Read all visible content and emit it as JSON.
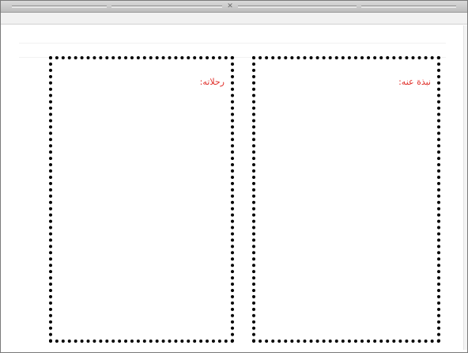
{
  "page": {
    "boxes": [
      {
        "id": "travels",
        "label": "رحلاته:"
      },
      {
        "id": "bio",
        "label": "نبذة عنه:"
      }
    ]
  },
  "colors": {
    "label": "#e0302a",
    "dotted_border": "#000000",
    "toolbar": "#c9c9c9"
  }
}
